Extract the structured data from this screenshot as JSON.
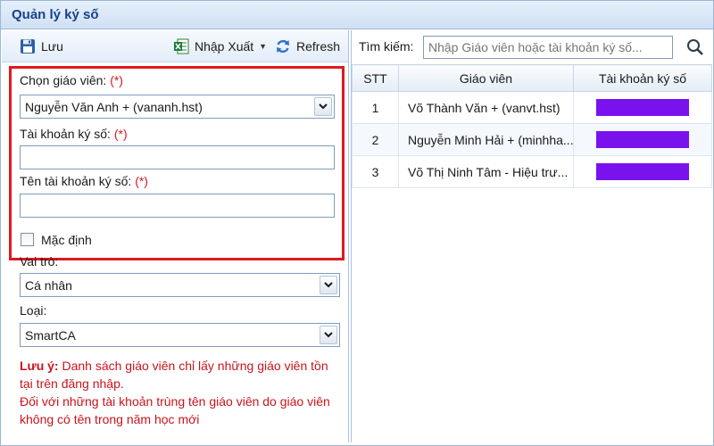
{
  "window": {
    "title": "Quản lý ký số"
  },
  "toolbar": {
    "save_label": "Lưu",
    "import_export_label": "Nhập Xuất",
    "refresh_label": "Refresh"
  },
  "form": {
    "teacher_label": "Chọn giáo viên:",
    "teacher_value": "Nguyễn Văn Anh + (vananh.hst)",
    "account_label": "Tài khoản ký số:",
    "account_value": "",
    "account_name_label": "Tên tài khoản ký số:",
    "account_name_value": "",
    "required_mark": "(*)",
    "default_label": "Mặc định",
    "default_checked": false,
    "role_label": "Vai trò:",
    "role_value": "Cá nhân",
    "type_label": "Loại:",
    "type_value": "SmartCA"
  },
  "note": {
    "title": "Lưu ý:",
    "line1": "Danh sách giáo viên chỉ lấy những giáo viên tồn tại trên đăng nhập.",
    "line2": "Đối với những tài khoản  trùng tên giáo viên do giáo viên không có tên trong năm học mới"
  },
  "search": {
    "label": "Tìm kiếm:",
    "placeholder": "Nhập Giáo viên hoặc tài khoản ký số..."
  },
  "table": {
    "columns": [
      "STT",
      "Giáo viên",
      "Tài khoản ký số"
    ],
    "rows": [
      {
        "stt": "1",
        "teacher": "Võ Thành Văn + (vanvt.hst)"
      },
      {
        "stt": "2",
        "teacher": "Nguyễn Minh Hải + (minhha..."
      },
      {
        "stt": "3",
        "teacher": "Võ Thị Ninh Tâm - Hiệu trư..."
      }
    ],
    "redacted_color": "#7a12ee"
  },
  "icons": {
    "save": "floppy-disk-icon",
    "import_export": "excel-icon",
    "refresh": "refresh-icon",
    "search": "magnifier-icon",
    "dropdown": "chevron-down-icon"
  }
}
